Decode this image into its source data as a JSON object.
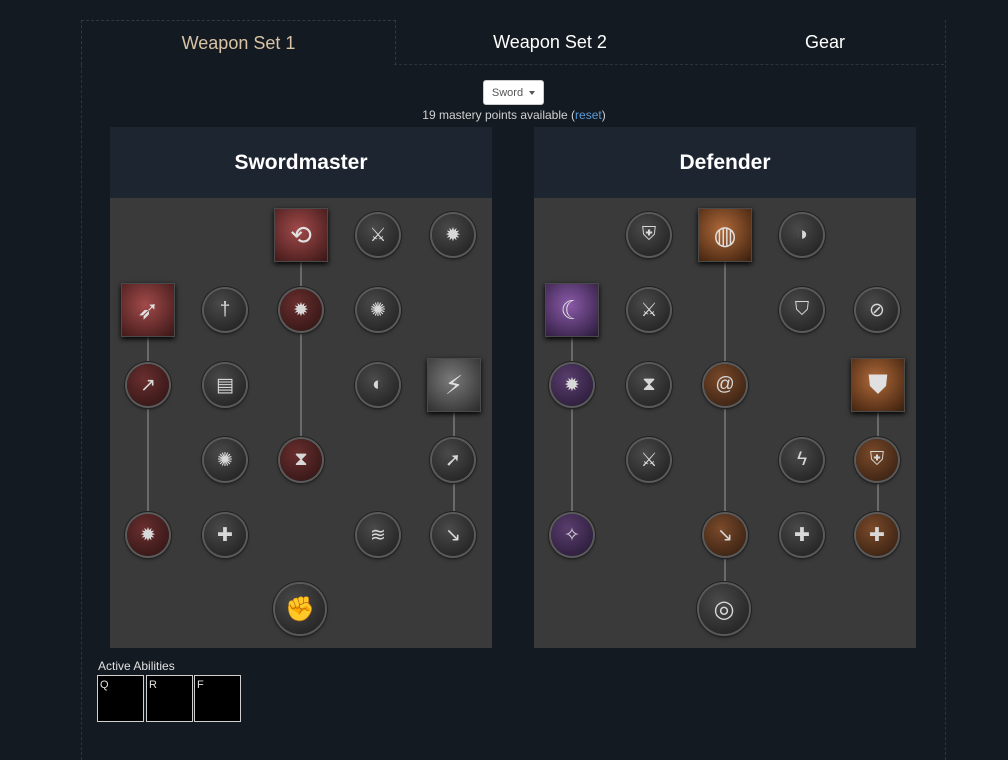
{
  "tabs": [
    {
      "label": "Weapon Set 1",
      "active": true
    },
    {
      "label": "Weapon Set 2",
      "active": false
    },
    {
      "label": "Gear",
      "active": false
    }
  ],
  "weapon_select": {
    "value": "Sword"
  },
  "mastery": {
    "text": "19 mastery points available (",
    "reset_label": "reset",
    "close": ")"
  },
  "trees": [
    {
      "title": "Swordmaster"
    },
    {
      "title": "Defender"
    }
  ],
  "active_abilities": {
    "label": "Active Abilities",
    "slots": [
      "Q",
      "R",
      "F"
    ]
  },
  "icons": {
    "sm_r0c2": "sword-slash-icon",
    "sm_r0c3": "blade-strike-icon",
    "sm_r0c4": "upgrade-star-icon",
    "sm_r1c0": "lunge-icon",
    "sm_r1c1": "sword-icon",
    "sm_r1c2": "empower-icon",
    "sm_r1c3": "whirlwind-icon",
    "sm_r2c0": "charge-icon",
    "sm_r2c1": "scroll-icon",
    "sm_r2c3": "shield-swirl-icon",
    "sm_r2c4": "leap-icon",
    "sm_r3c1": "burst-icon",
    "sm_r3c2": "hourglass-down-icon",
    "sm_r3c4": "arrow-up-icon",
    "sm_r4c0": "empower-star-icon",
    "sm_r4c1": "heal-cross-icon",
    "sm_r4c3": "haste-boot-icon",
    "sm_r4c4": "boot-strike-icon",
    "sm_r5c2": "rally-icon",
    "df_r0c1": "armor-icon",
    "df_r0c2": "shield-rush-icon",
    "df_r0c3": "shield-curve-icon",
    "df_r1c0": "shield-bash-icon",
    "df_r1c1": "sword-shield-icon",
    "df_r1c3": "shield-down-icon",
    "df_r1c4": "shield-slash-icon",
    "df_r2c0": "fortify-icon",
    "df_r2c1": "hourglass-icon",
    "df_r2c2": "vortex-icon",
    "df_r2c4": "defense-shield-icon",
    "df_r3c1": "blade-icon",
    "df_r3c3": "lightning-icon",
    "df_r3c4": "shield-heal-icon",
    "df_r4c0": "stars-orbit-icon",
    "df_r4c2": "stomp-icon",
    "df_r4c3": "plus-icon",
    "df_r4c4": "health-cross-icon",
    "df_r5c2": "spin-icon"
  }
}
